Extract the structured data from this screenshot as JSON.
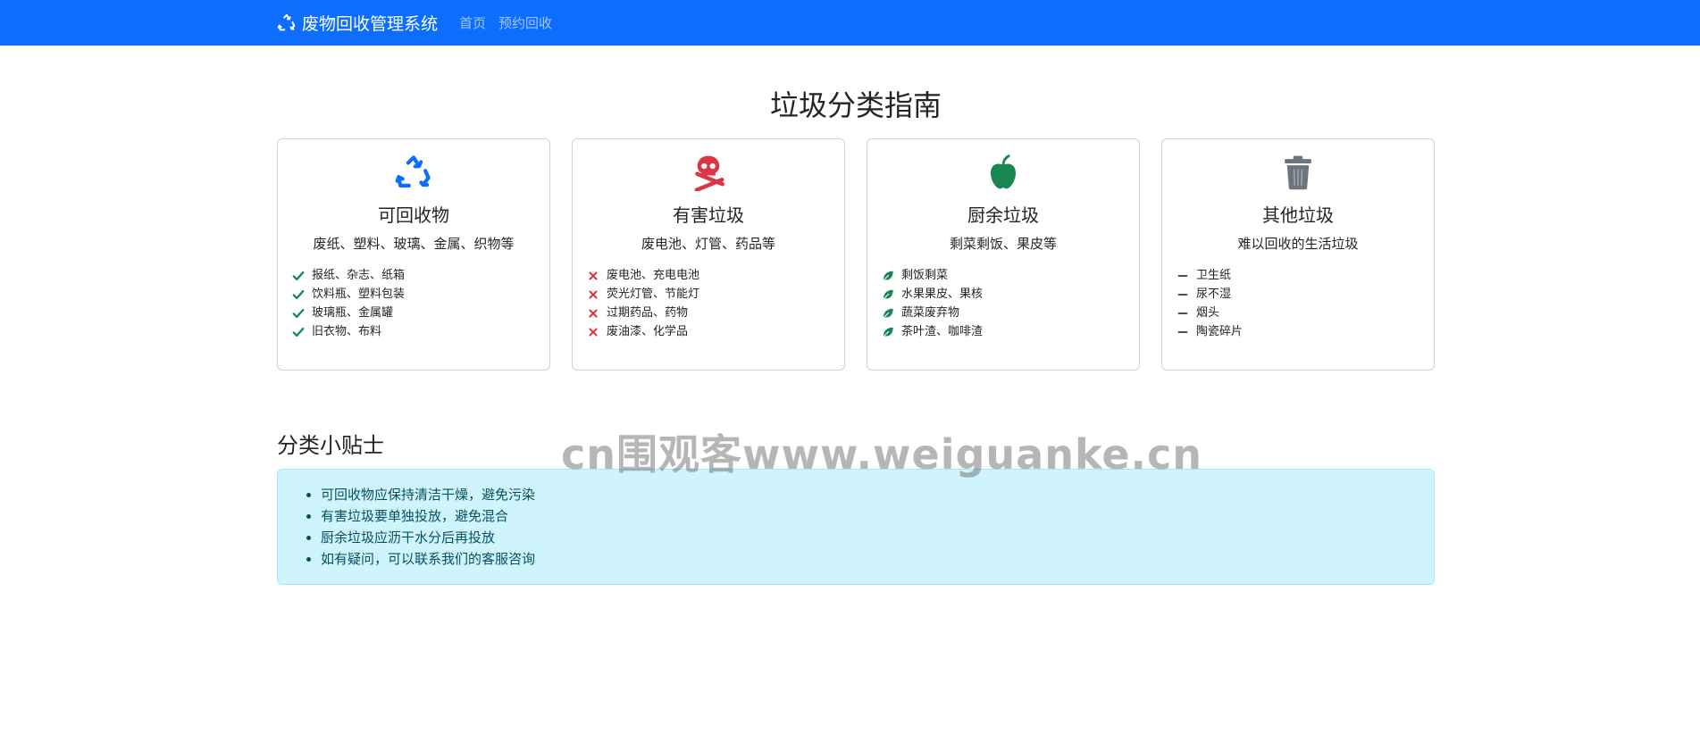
{
  "nav": {
    "brand": "废物回收管理系统",
    "links": [
      "首页",
      "预约回收"
    ]
  },
  "page_title": "垃圾分类指南",
  "cards": [
    {
      "icon": "recycle-icon",
      "title": "可回收物",
      "desc": "废纸、塑料、玻璃、金属、织物等",
      "item_icon": "check-icon",
      "items": [
        "报纸、杂志、纸箱",
        "饮料瓶、塑料包装",
        "玻璃瓶、金属罐",
        "旧衣物、布料"
      ]
    },
    {
      "icon": "skull-crossbones-icon",
      "title": "有害垃圾",
      "desc": "废电池、灯管、药品等",
      "item_icon": "x-icon",
      "items": [
        "废电池、充电电池",
        "荧光灯管、节能灯",
        "过期药品、药物",
        "废油漆、化学品"
      ]
    },
    {
      "icon": "apple-icon",
      "title": "厨余垃圾",
      "desc": "剩菜剩饭、果皮等",
      "item_icon": "leaf-icon",
      "items": [
        "剩饭剩菜",
        "水果果皮、果核",
        "蔬菜废弃物",
        "茶叶渣、咖啡渣"
      ]
    },
    {
      "icon": "trash-icon",
      "title": "其他垃圾",
      "desc": "难以回收的生活垃圾",
      "item_icon": "dash-icon",
      "items": [
        "卫生纸",
        "尿不湿",
        "烟头",
        "陶瓷碎片"
      ]
    }
  ],
  "tips": {
    "title": "分类小贴士",
    "items": [
      "可回收物应保持清洁干燥，避免污染",
      "有害垃圾要单独投放，避免混合",
      "厨余垃圾应沥干水分后再投放",
      "如有疑问，可以联系我们的客服咨询"
    ]
  },
  "watermark": "cn围观客www.weiguanke.cn",
  "colors": {
    "primary": "#0d6efd",
    "danger": "#dc3545",
    "success": "#198754",
    "secondary": "#6c757d",
    "info_bg": "#cff4fc"
  }
}
